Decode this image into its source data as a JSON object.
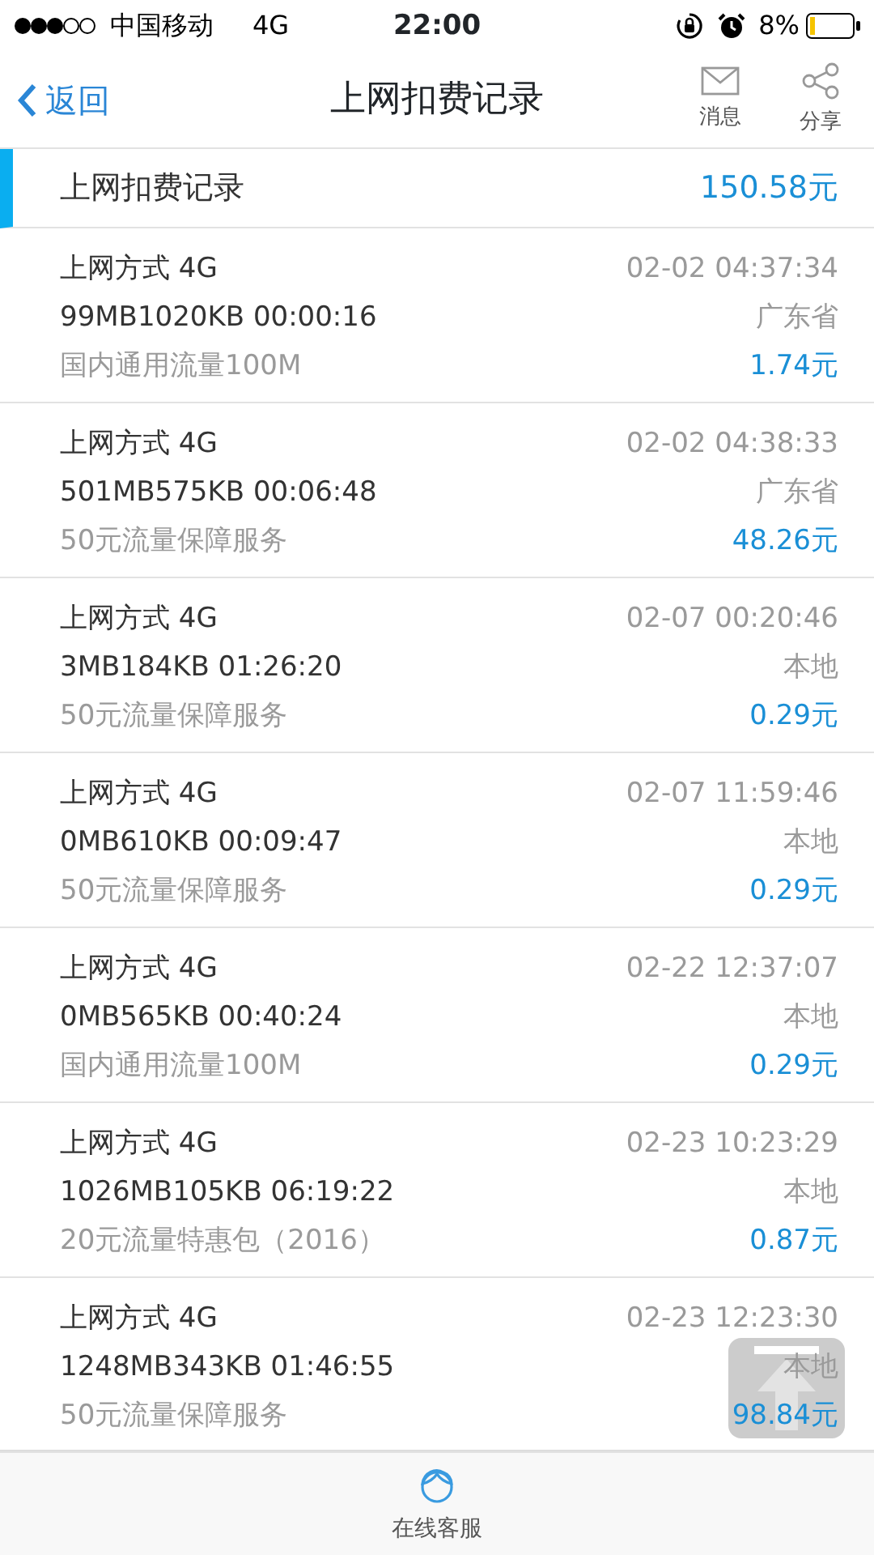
{
  "status_bar": {
    "carrier": "中国移动",
    "network": "4G",
    "time": "22:00",
    "battery": "8%"
  },
  "nav": {
    "back": "返回",
    "title": "上网扣费记录",
    "actions": [
      {
        "kind": "mail",
        "label": "消息"
      },
      {
        "kind": "share",
        "label": "分享"
      }
    ]
  },
  "summary": {
    "label": "上网扣费记录",
    "amount": "150.58元"
  },
  "records": [
    {
      "type": "上网方式 4G",
      "time": "02-02 04:37:34",
      "usage": "99MB1020KB 00:00:16",
      "region": "广东省",
      "package": "国内通用流量100M",
      "amount": "1.74元"
    },
    {
      "type": "上网方式 4G",
      "time": "02-02 04:38:33",
      "usage": "501MB575KB 00:06:48",
      "region": "广东省",
      "package": "50元流量保障服务",
      "amount": "48.26元"
    },
    {
      "type": "上网方式 4G",
      "time": "02-07 00:20:46",
      "usage": "3MB184KB 01:26:20",
      "region": "本地",
      "package": "50元流量保障服务",
      "amount": "0.29元"
    },
    {
      "type": "上网方式 4G",
      "time": "02-07 11:59:46",
      "usage": "0MB610KB 00:09:47",
      "region": "本地",
      "package": "50元流量保障服务",
      "amount": "0.29元"
    },
    {
      "type": "上网方式 4G",
      "time": "02-22 12:37:07",
      "usage": "0MB565KB 00:40:24",
      "region": "本地",
      "package": "国内通用流量100M",
      "amount": "0.29元"
    },
    {
      "type": "上网方式 4G",
      "time": "02-23 10:23:29",
      "usage": "1026MB105KB 06:19:22",
      "region": "本地",
      "package": "20元流量特惠包（2016）",
      "amount": "0.87元"
    },
    {
      "type": "上网方式 4G",
      "time": "02-23 12:23:30",
      "usage": "1248MB343KB 01:46:55",
      "region": "本地",
      "package": "50元流量保障服务",
      "amount": "98.84元"
    }
  ],
  "tab_bar": {
    "label": "在线客服"
  }
}
